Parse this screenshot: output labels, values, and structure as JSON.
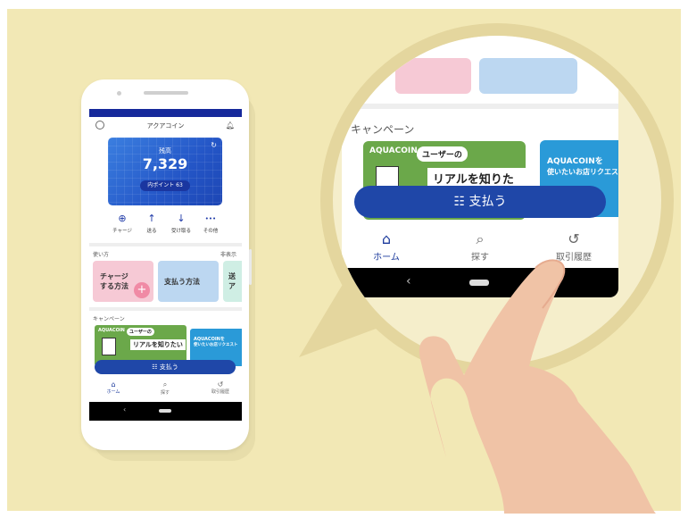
{
  "app": {
    "title": "アクアコイン",
    "balance_label": "残高",
    "balance_amount": "7,329",
    "points_label": "内ポイント  63"
  },
  "actions": [
    {
      "icon": "plus-circle-icon",
      "glyph": "⊕",
      "label": "チャージ"
    },
    {
      "icon": "send-icon",
      "glyph": "↑",
      "label": "送る"
    },
    {
      "icon": "receive-icon",
      "glyph": "↓",
      "label": "受け取る"
    },
    {
      "icon": "more-icon",
      "glyph": "•••",
      "label": "その他"
    }
  ],
  "howto": {
    "title": "使い方",
    "hide_label": "非表示",
    "cards": [
      {
        "label": "チャージ\nする方法",
        "color": "#f6c9d5"
      },
      {
        "label": "支払う方法",
        "color": "#bcd7f1"
      },
      {
        "label": "送\nア",
        "color": "#cfeee4"
      }
    ]
  },
  "campaign": {
    "title": "キャンペーン",
    "banner1": {
      "brand": "AQUACOIN",
      "line1": "ユーザーの",
      "line2": "リアルを知りたい"
    },
    "banner2": {
      "line1": "AQUACOINを",
      "line2": "使いたいお店リクエスト"
    }
  },
  "pay_button": {
    "label": "支払う",
    "icon": "qr-icon"
  },
  "bottom_nav": [
    {
      "icon": "home-icon",
      "label": "ホーム",
      "active": true
    },
    {
      "icon": "search-icon",
      "label": "探す",
      "active": false
    },
    {
      "icon": "history-icon",
      "label": "取引履歴",
      "active": false
    }
  ],
  "colors": {
    "background": "#f2e8b5",
    "primary": "#1f47a8",
    "header_bar": "#16299b",
    "hand": "#f0c3a6"
  }
}
